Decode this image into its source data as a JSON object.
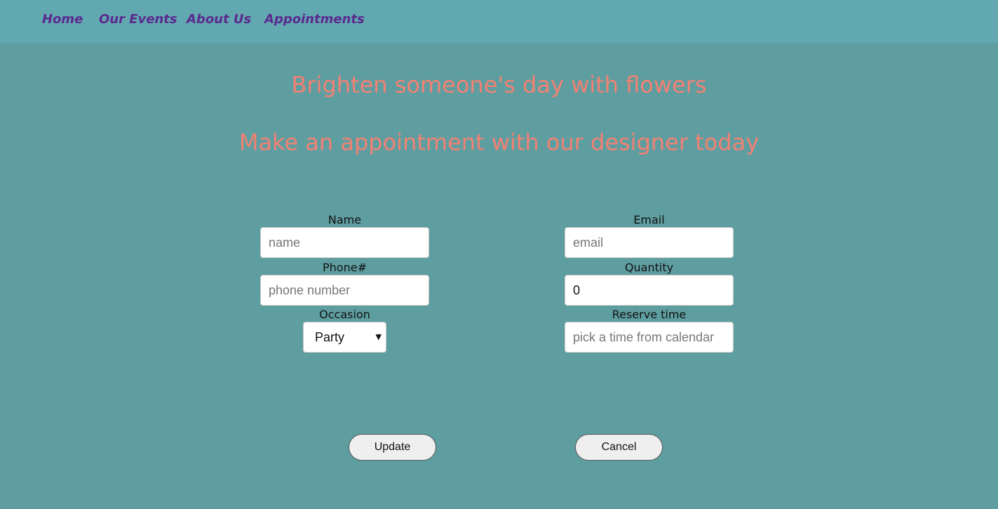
{
  "nav": {
    "items": [
      {
        "label": "Home"
      },
      {
        "label": "Our Events"
      },
      {
        "label": "About Us"
      },
      {
        "label": "Appointments"
      }
    ]
  },
  "headings": {
    "line1": "Brighten someone's day with flowers",
    "line2": "Make an appointment with our designer today"
  },
  "form": {
    "name": {
      "label": "Name",
      "placeholder": "name",
      "value": ""
    },
    "phone": {
      "label": "Phone#",
      "placeholder": "phone number",
      "value": ""
    },
    "occasion": {
      "label": "Occasion",
      "selected": "Party"
    },
    "email": {
      "label": "Email",
      "placeholder": "email",
      "value": ""
    },
    "quantity": {
      "label": "Quantity",
      "value": "0"
    },
    "reserve_time": {
      "label": "Reserve time",
      "placeholder": "pick a time from calendar",
      "value": ""
    }
  },
  "buttons": {
    "update": "Update",
    "cancel": "Cancel"
  },
  "colors": {
    "background": "#5f9ea0",
    "navbar": "#62a8b0",
    "nav_link": "#5a2a8f",
    "heading": "#f28173"
  }
}
